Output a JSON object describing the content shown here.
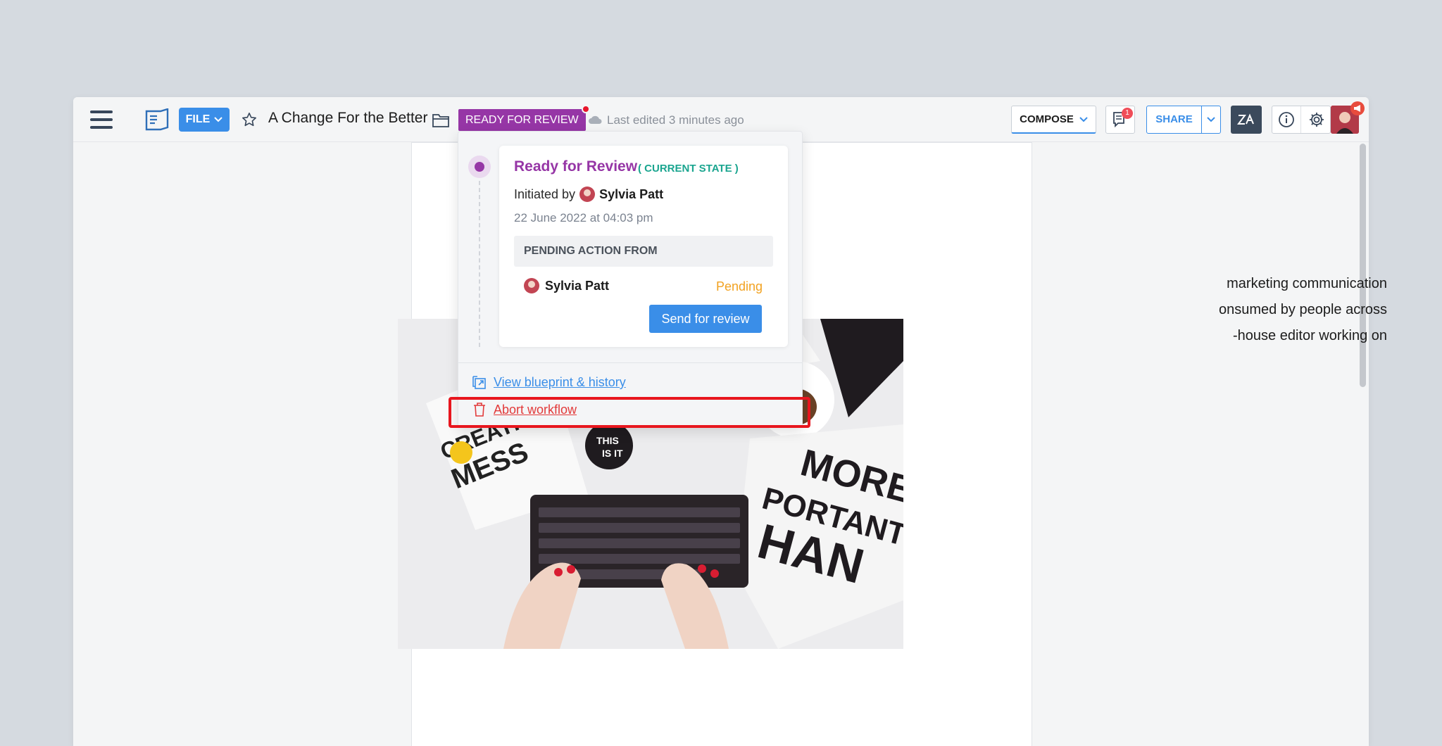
{
  "toolbar": {
    "file_label": "FILE",
    "doc_title": "A Change For the Better",
    "status_label": "READY FOR REVIEW",
    "last_edited": "Last edited 3 minutes ago",
    "compose_label": "COMPOSE",
    "comment_count": "1",
    "share_label": "SHARE"
  },
  "document": {
    "para_lines": [
      "marketing communication",
      "onsumed by people across",
      "-house editor working on"
    ]
  },
  "popover": {
    "card": {
      "title": "Ready for Review",
      "state_tag": "( CURRENT STATE )",
      "initiated_prefix": "Initiated by",
      "initiator": "Sylvia Patt",
      "date": "22 June 2022 at 04:03 pm",
      "pending_header": "PENDING ACTION FROM",
      "assignee": "Sylvia Patt",
      "assignee_status": "Pending",
      "send_button": "Send for review"
    },
    "links": {
      "history": "View blueprint & history",
      "abort": "Abort workflow"
    }
  },
  "colors": {
    "accent": "#3a8ee8",
    "status_purple": "#9636a6",
    "current_state": "#1aa58f",
    "pending": "#f2a221",
    "danger": "#e23a3a"
  },
  "icons": [
    "hamburger-icon",
    "document-icon",
    "star-icon",
    "folder-icon",
    "cloud-icon",
    "chevron-down-icon",
    "comments-icon",
    "zia-icon",
    "info-icon",
    "gear-icon",
    "megaphone-icon",
    "external-link-icon",
    "trash-icon",
    "plus-icon",
    "text-block-icon"
  ]
}
